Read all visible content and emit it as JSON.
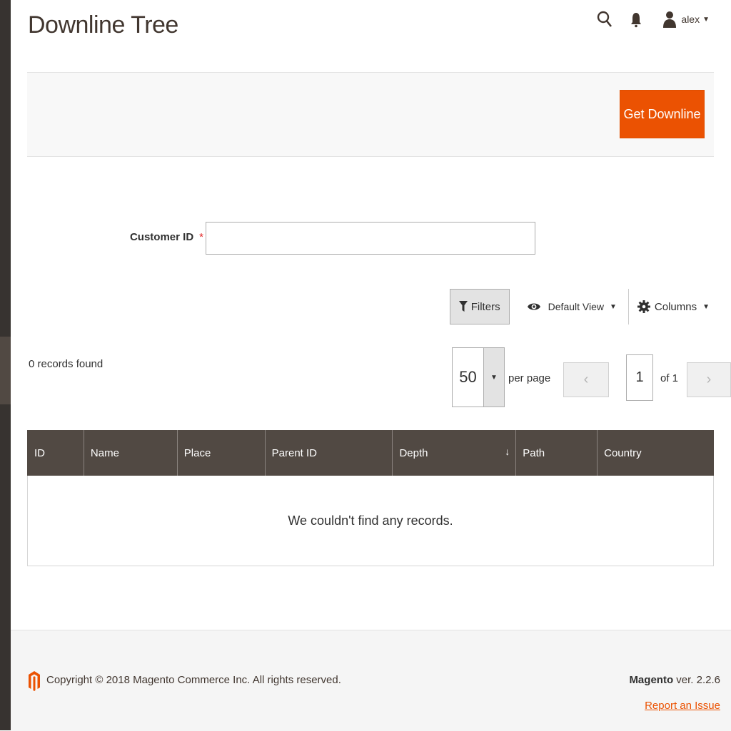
{
  "page": {
    "title": "Downline Tree"
  },
  "header": {
    "user_name": "alex"
  },
  "actions": {
    "get_downline_label": "Get Downline"
  },
  "form": {
    "customer_id_label": "Customer ID",
    "required_mark": "*",
    "customer_id_value": ""
  },
  "grid_controls": {
    "filters_label": "Filters",
    "view_label": "Default View",
    "columns_label": "Columns"
  },
  "pagination": {
    "records_found": "0 records found",
    "per_page_value": "50",
    "per_page_label": "per page",
    "current_page": "1",
    "total_pages_label": "of 1",
    "prev_symbol": "‹",
    "next_symbol": "›"
  },
  "table": {
    "columns": [
      "ID",
      "Name",
      "Place",
      "Parent ID",
      "Depth",
      "Path",
      "Country"
    ],
    "empty_message": "We couldn't find any records."
  },
  "footer": {
    "copyright": "Copyright © 2018 Magento Commerce Inc. All rights reserved.",
    "brand": "Magento",
    "version": "ver. 2.2.6",
    "report_link": "Report an Issue"
  },
  "colors": {
    "accent": "#eb5202",
    "grid_header": "#514943",
    "sidebar": "#373330"
  },
  "icons": {
    "search": "search-icon",
    "notifications": "bell-icon",
    "user": "user-icon",
    "filter": "funnel-icon",
    "view": "eye-icon",
    "columns": "gear-icon",
    "logo": "magento-logo-icon"
  }
}
